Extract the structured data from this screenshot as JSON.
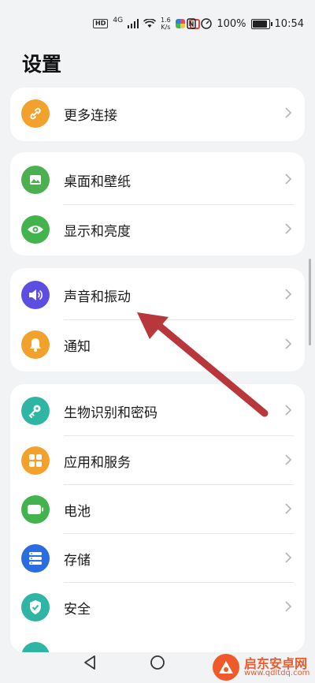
{
  "status_bar": {
    "hd": "HD",
    "network": "4G",
    "speed_top": "1.6",
    "speed_bottom": "K/s",
    "battery_pct": "100%",
    "battery_level": 1.0,
    "time": "10:54"
  },
  "page_title": "设置",
  "groups": [
    {
      "items": [
        {
          "label": "更多连接",
          "icon": "link-icon",
          "color": "#f2a12d"
        }
      ]
    },
    {
      "items": [
        {
          "label": "桌面和壁纸",
          "icon": "wallpaper-icon",
          "color": "#4caf50"
        },
        {
          "label": "显示和亮度",
          "icon": "eye-icon",
          "color": "#43b34d"
        }
      ]
    },
    {
      "items": [
        {
          "label": "声音和振动",
          "icon": "speaker-icon",
          "color": "#5b4ee0"
        },
        {
          "label": "通知",
          "icon": "bell-icon",
          "color": "#f2a12d"
        }
      ]
    },
    {
      "items": [
        {
          "label": "生物识别和密码",
          "icon": "key-icon",
          "color": "#2fb5a3"
        },
        {
          "label": "应用和服务",
          "icon": "apps-grid-icon",
          "color": "#f2a12d"
        },
        {
          "label": "电池",
          "icon": "battery-icon",
          "color": "#43b34d"
        },
        {
          "label": "存储",
          "icon": "storage-icon",
          "color": "#2a6de0"
        },
        {
          "label": "安全",
          "icon": "shield-icon",
          "color": "#2fb5a3"
        }
      ]
    }
  ],
  "annotation_color": "#b8373a",
  "watermark": {
    "title": "启东安卓网",
    "url": "www.qdltdq.com"
  }
}
